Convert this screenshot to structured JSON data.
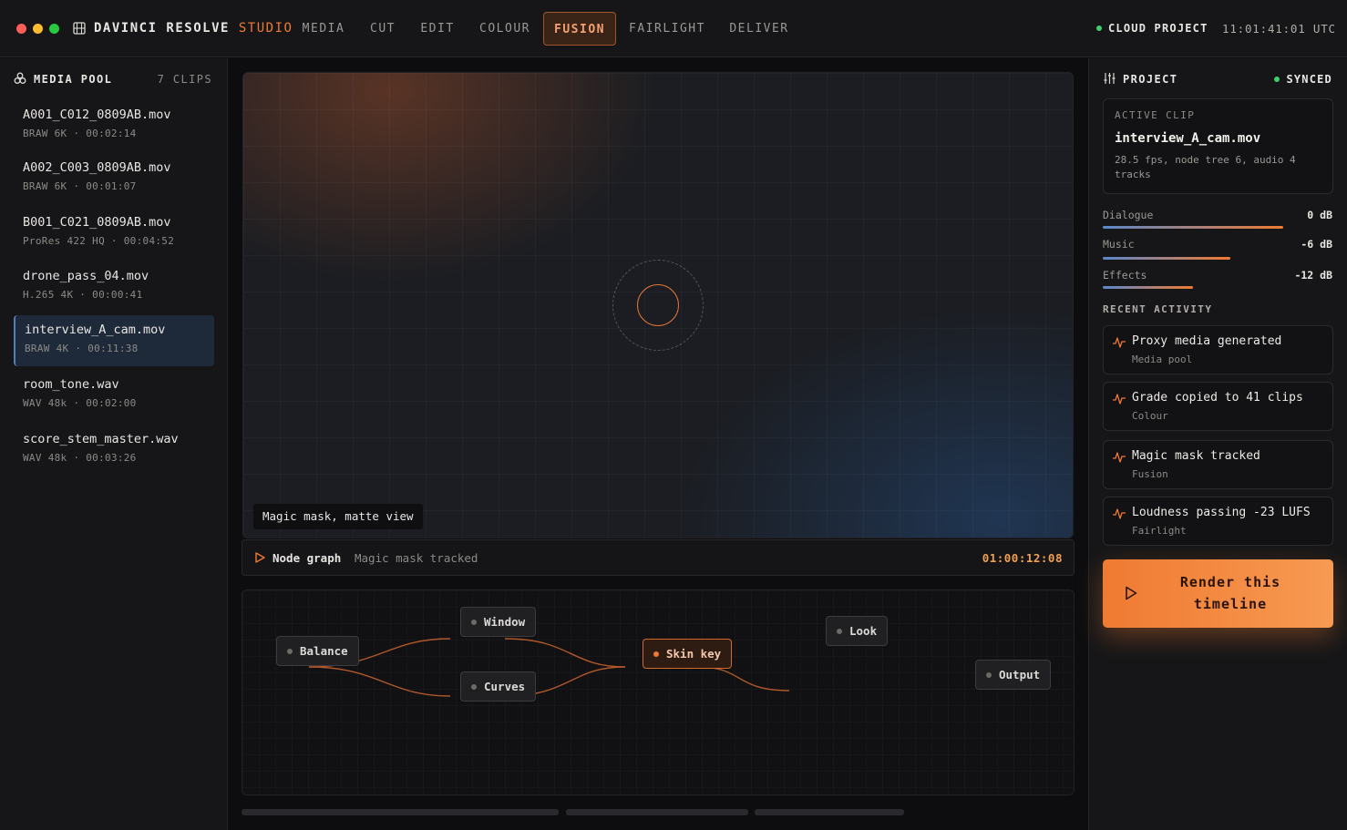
{
  "topbar": {
    "brand_main": "DAVINCI RESOLVE",
    "brand_accent": "STUDIO",
    "tabs": [
      {
        "label": "MEDIA",
        "active": false
      },
      {
        "label": "CUT",
        "active": false
      },
      {
        "label": "EDIT",
        "active": false
      },
      {
        "label": "COLOUR",
        "active": false
      },
      {
        "label": "FUSION",
        "active": true
      },
      {
        "label": "FAIRLIGHT",
        "active": false
      },
      {
        "label": "DELIVER",
        "active": false
      }
    ],
    "status": "CLOUD PROJECT",
    "clock": "11:01:41:01 UTC",
    "window_dots": [
      "#ff5f57",
      "#febc2e",
      "#28c840"
    ]
  },
  "media_pool": {
    "title": "MEDIA POOL",
    "count": "7 CLIPS",
    "clips": [
      {
        "name": "A001_C012_0809AB.mov",
        "meta": "BRAW 6K · 00:02:14",
        "selected": false
      },
      {
        "name": "A002_C003_0809AB.mov",
        "meta": "BRAW 6K · 00:01:07",
        "selected": false
      },
      {
        "name": "B001_C021_0809AB.mov",
        "meta": "ProRes 422 HQ · 00:04:52",
        "selected": false
      },
      {
        "name": "drone_pass_04.mov",
        "meta": "H.265 4K · 00:00:41",
        "selected": false
      },
      {
        "name": "interview_A_cam.mov",
        "meta": "BRAW 4K · 00:11:38",
        "selected": true
      },
      {
        "name": "room_tone.wav",
        "meta": "WAV 48k · 00:02:00",
        "selected": false
      },
      {
        "name": "score_stem_master.wav",
        "meta": "WAV 48k · 00:03:26",
        "selected": false
      }
    ]
  },
  "viewer": {
    "caption": "Magic mask, matte view"
  },
  "node_bar": {
    "title": "Node graph",
    "subtitle": "Magic mask tracked",
    "timecode": "01:00:12:08"
  },
  "nodes": [
    {
      "label": "Balance",
      "active": false
    },
    {
      "label": "Window",
      "active": false
    },
    {
      "label": "Curves",
      "active": false
    },
    {
      "label": "Skin key",
      "active": true
    },
    {
      "label": "Look",
      "active": false
    },
    {
      "label": "Output",
      "active": false
    }
  ],
  "project": {
    "title": "PROJECT",
    "sync_status": "SYNCED",
    "active_clip_label": "ACTIVE CLIP",
    "active_clip_name": "interview_A_cam.mov",
    "active_clip_meta": "28.5 fps, node tree 6, audio 4 tracks",
    "meters": [
      {
        "label": "Dialogue",
        "value": "0 dB",
        "level": 0.88
      },
      {
        "label": "Music",
        "value": "-6 dB",
        "level": 0.62
      },
      {
        "label": "Effects",
        "value": "-12 dB",
        "level": 0.44
      }
    ],
    "recent_title": "RECENT ACTIVITY",
    "activity": [
      {
        "title": "Proxy media generated",
        "source": "Media pool"
      },
      {
        "title": "Grade copied to 41 clips",
        "source": "Colour"
      },
      {
        "title": "Magic mask tracked",
        "source": "Fusion"
      },
      {
        "title": "Loudness passing -23 LUFS",
        "source": "Fairlight"
      }
    ],
    "render_label": "Render this timeline"
  },
  "colors": {
    "accent": "#f07a32",
    "success": "#3ecf6e",
    "selection": "#1e2a3a"
  }
}
